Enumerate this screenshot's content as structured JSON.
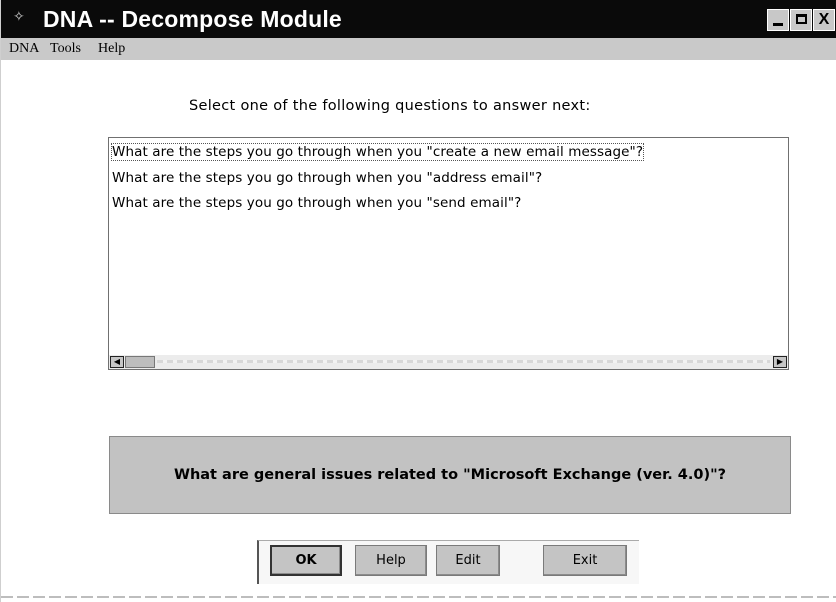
{
  "window": {
    "title": "DNA -- Decompose Module",
    "controls": {
      "minimize": "minimize",
      "maximize": "maximize",
      "close": "X"
    }
  },
  "menu": {
    "items": [
      {
        "label": "DNA"
      },
      {
        "label": "Tools"
      },
      {
        "label": "Help"
      }
    ]
  },
  "main": {
    "prompt": "Select one of the following questions to answer next:",
    "questions": [
      "What are the steps you go through when you \"create a new email message\"?",
      "What are the steps you go through when you \"address email\"?",
      "What are the steps you go through when you \"send email\"?"
    ],
    "general_question": "What are general issues related to \"Microsoft Exchange (ver. 4.0)\"?"
  },
  "buttons": {
    "ok": "OK",
    "help": "Help",
    "edit": "Edit",
    "exit": "Exit"
  }
}
